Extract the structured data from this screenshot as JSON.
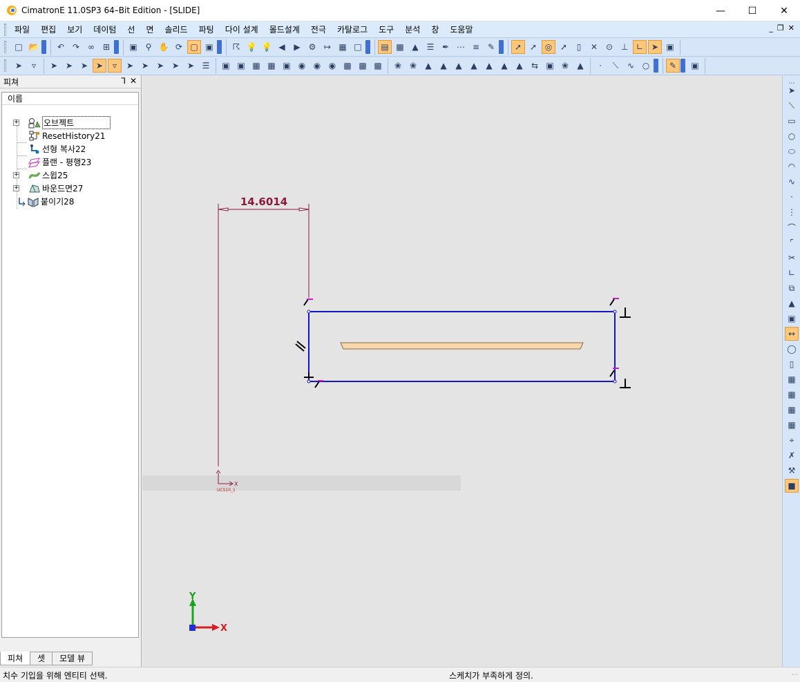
{
  "window": {
    "title": "CimatronE 11.0SP3 64–Bit Edition - [SLIDE]",
    "minimize": "—",
    "maximize": "☐",
    "close": "✕"
  },
  "menubar": {
    "items": [
      "파일",
      "편집",
      "보기",
      "데이텀",
      "선",
      "면",
      "솔리드",
      "파팅",
      "다이 설계",
      "몰드설계",
      "전극",
      "카탈로그",
      "도구",
      "분석",
      "창",
      "도움말"
    ],
    "mdi_minimize": "_",
    "mdi_restore": "❐",
    "mdi_close": "✕"
  },
  "feature_panel": {
    "title": "피쳐",
    "pin": "⅂",
    "close": "✕",
    "column_header": "이름",
    "items": [
      {
        "label": "오브젝트",
        "icon": "object-group-icon",
        "expandable": true,
        "selected": true
      },
      {
        "label": "ResetHistory21",
        "icon": "reset-history-icon",
        "expandable": false
      },
      {
        "label": "선형 복사22",
        "icon": "linear-copy-icon",
        "expandable": false
      },
      {
        "label": "플랜 - 평행23",
        "icon": "plane-parallel-icon",
        "expandable": false
      },
      {
        "label": "스윕25",
        "icon": "sweep-icon",
        "expandable": true
      },
      {
        "label": "바운드면27",
        "icon": "bounded-face-icon",
        "expandable": true
      },
      {
        "label": "붙이기28",
        "icon": "attach-icon",
        "expandable": false
      }
    ],
    "tabs": [
      "피쳐",
      "셋",
      "모델 뷰"
    ],
    "active_tab": 0
  },
  "viewport": {
    "dimension_value": "14.6014",
    "ucs_label": "UCS10_1",
    "ucs_x": "X",
    "triad_x": "X",
    "triad_y": "Y",
    "colors": {
      "background": "#e4e4e4",
      "sketch_rect": "#1515c8",
      "dimension": "#8b1a3a",
      "constraint": "#c21cc8",
      "x_axis": "#d31f1f",
      "y_axis": "#19a31f",
      "z_axis": "#1f2fd3",
      "part_fill": "#f7d7ab"
    }
  },
  "statusbar": {
    "left": "치수 기입을 위해 엔티티 선택.",
    "right": "스케치가 부족하게 정의."
  }
}
